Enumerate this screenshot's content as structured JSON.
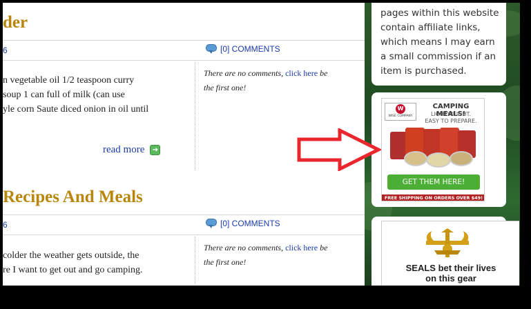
{
  "posts": [
    {
      "title": "der",
      "meta_left": "6",
      "comments_label": "[0] COMMENTS",
      "excerpt_lines": [
        "n vegetable oil 1/2 teaspoon curry",
        "soup 1 can full of milk (can use",
        "yle corn Saute diced onion in oil until"
      ],
      "read_more": "read more",
      "comment_note": "There are no comments,",
      "comment_link": "click here",
      "comment_suffix": "be",
      "comment_line2": "the first one!"
    },
    {
      "title": "Recipes And Meals",
      "meta_left": "6",
      "comments_label": "[0] COMMENTS",
      "excerpt_lines": [
        "colder the weather gets outside, the",
        "re I want to get out and go camping."
      ],
      "comment_note": "There are no comments,",
      "comment_link": "click here",
      "comment_suffix": "be",
      "comment_line2": "the first one!"
    }
  ],
  "sidebar": {
    "disclosure": "pages within this website contain affiliate links, which means I may earn a small commission if an item is purchased.",
    "ad1": {
      "headline": "CAMPING MEALS!",
      "subline1": "LIGHTWEIGHT.",
      "subline2": "EASY TO PREPARE.",
      "logo_letter": "W",
      "logo_text": "WISE COMPANY",
      "cta": "GET THEM HERE!",
      "shipping": "FREE SHIPPING ON ORDERS OVER $49!"
    },
    "ad2": {
      "line1": "SEALS bet their lives",
      "line2": "on this gear"
    }
  },
  "colors": {
    "title": "#b8860b",
    "link": "#1a3aa8",
    "arrow": "#e8262b",
    "cta": "#4caf35"
  }
}
